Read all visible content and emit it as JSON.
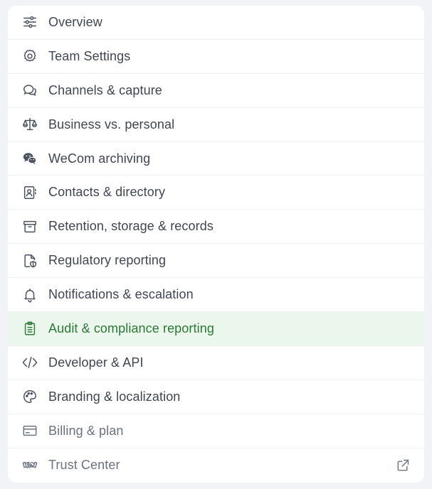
{
  "nav": {
    "items": [
      {
        "label": "Overview",
        "icon": "sliders-icon"
      },
      {
        "label": "Team Settings",
        "icon": "gear-icon"
      },
      {
        "label": "Channels & capture",
        "icon": "chat-bubbles-icon"
      },
      {
        "label": "Business vs. personal",
        "icon": "scale-icon"
      },
      {
        "label": "WeCom archiving",
        "icon": "wechat-icon"
      },
      {
        "label": "Contacts & directory",
        "icon": "contact-book-icon"
      },
      {
        "label": "Retention, storage & records",
        "icon": "archive-box-icon"
      },
      {
        "label": "Regulatory reporting",
        "icon": "file-shield-icon"
      },
      {
        "label": "Notifications & escalation",
        "icon": "bell-icon"
      },
      {
        "label": "Audit & compliance reporting",
        "icon": "clipboard-list-icon",
        "active": true
      },
      {
        "label": "Developer & API",
        "icon": "code-icon"
      },
      {
        "label": "Branding & localization",
        "icon": "palette-icon"
      },
      {
        "label": "Billing & plan",
        "icon": "credit-card-icon"
      },
      {
        "label": "Trust Center",
        "icon": "handshake-icon",
        "external": true
      }
    ]
  },
  "colors": {
    "active_bg": "#ebf6ec",
    "active_text": "#2b7a36",
    "text": "#3f4652",
    "page_bg": "#f1f3f6"
  }
}
